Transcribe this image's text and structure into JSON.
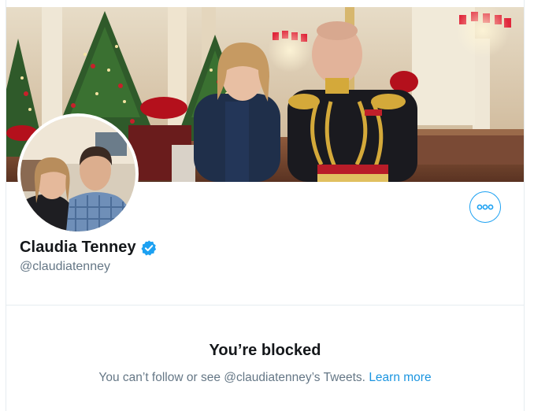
{
  "profile": {
    "display_name": "Claudia Tenney",
    "handle": "@claudiatenney",
    "verified": true,
    "verified_icon": "verified-badge-icon",
    "more_icon": "more-options-icon"
  },
  "blocked": {
    "title": "You’re blocked",
    "message": "You can’t follow or see @claudiatenney’s Tweets.",
    "link_text": "Learn more"
  },
  "colors": {
    "accent": "#1da1f2",
    "text_primary": "#14171a",
    "text_secondary": "#657786",
    "border": "#e6ecf0"
  }
}
